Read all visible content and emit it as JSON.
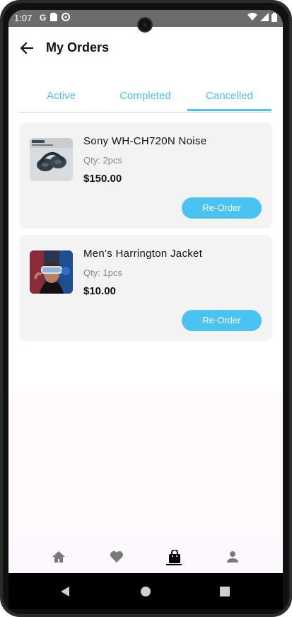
{
  "status_bar": {
    "time": "1:07",
    "left_icons": [
      "google-icon",
      "sim-card-icon",
      "data-saver-icon"
    ],
    "right_icons": [
      "wifi-icon",
      "signal-icon",
      "battery-icon"
    ]
  },
  "header": {
    "title": "My Orders",
    "back_icon": "arrow-left-icon"
  },
  "tabs": [
    {
      "label": "Active",
      "active": false
    },
    {
      "label": "Completed",
      "active": false
    },
    {
      "label": "Cancelled",
      "active": true
    }
  ],
  "orders": [
    {
      "name": "Sony WH-CH720N Noise",
      "qty": "Qty: 2pcs",
      "price": "$150.00",
      "button": "Re-Order",
      "image": "headphones-product-image"
    },
    {
      "name": "Men's Harrington Jacket",
      "qty": "Qty: 1pcs",
      "price": "$10.00",
      "button": "Re-Order",
      "image": "vr-headset-product-image"
    }
  ],
  "bottom_nav": [
    {
      "icon": "home-icon",
      "active": false
    },
    {
      "icon": "heart-icon",
      "active": false
    },
    {
      "icon": "shopping-bag-icon",
      "active": true
    },
    {
      "icon": "person-icon",
      "active": false
    }
  ],
  "system_nav": [
    "back-triangle-icon",
    "home-circle-icon",
    "recents-square-icon"
  ],
  "colors": {
    "accent": "#4ac3f2",
    "card_bg": "#f3f3f3",
    "status_bar": "#6b6b6b",
    "nav_bg": "#fdf8fd"
  }
}
